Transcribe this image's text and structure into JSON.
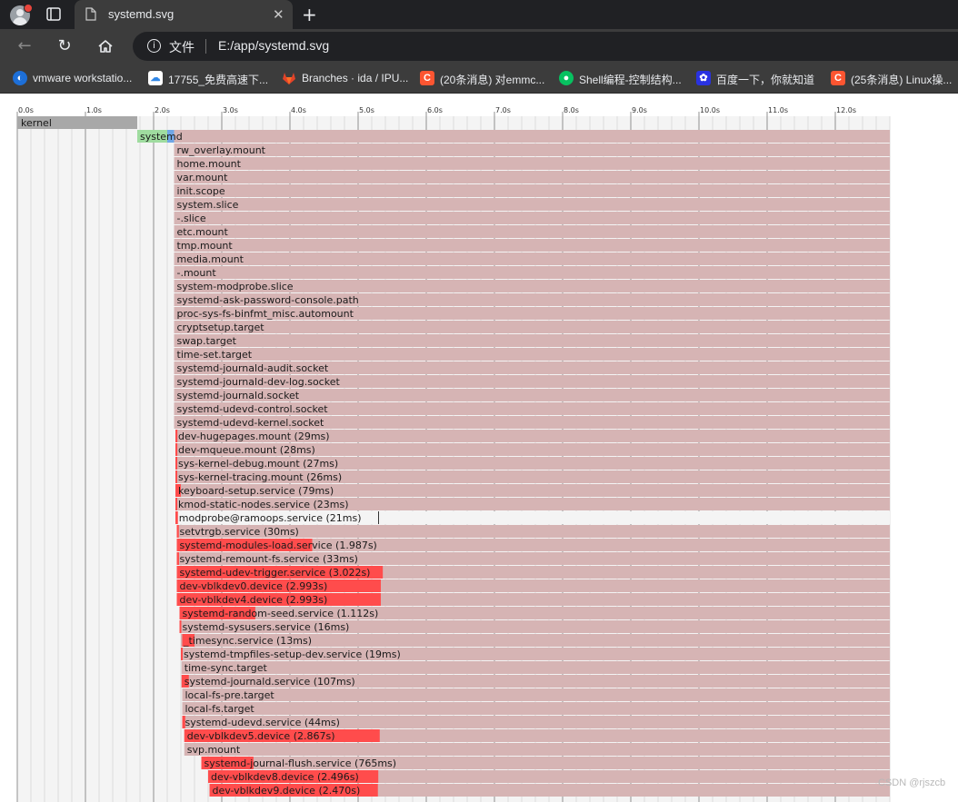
{
  "browser": {
    "tab_title": "systemd.svg",
    "address_chip": "文件",
    "url": "E:/app/systemd.svg",
    "colors": {
      "titlebar": "#202124",
      "toolbar": "#3c3c3c"
    }
  },
  "bookmarks": [
    {
      "label": "vmware workstatio...",
      "icon": "vmware-icon",
      "color": "#1d6fd8"
    },
    {
      "label": "17755_免费高速下...",
      "icon": "cloud-icon",
      "color": "#2f86e6"
    },
    {
      "label": "Branches · ida / IPU...",
      "icon": "gitlab-icon",
      "color": "#e24329"
    },
    {
      "label": "(20条消息) 对emmc...",
      "icon": "csdn-icon",
      "color": "#fc5531"
    },
    {
      "label": "Shell编程-控制结构...",
      "icon": "wechat-icon",
      "color": "#07c160"
    },
    {
      "label": "百度一下，你就知道",
      "icon": "baidu-icon",
      "color": "#2932e1"
    },
    {
      "label": "(25条消息) Linux操...",
      "icon": "csdn-icon",
      "color": "#fc5531"
    }
  ],
  "watermark": "CSDN @rjszcb",
  "chart_data": {
    "type": "bootchart-timeline",
    "x_unit": "s",
    "xlim": [
      0.0,
      12.8
    ],
    "ticks": [
      "0.0s",
      "1.0s",
      "2.0s",
      "3.0s",
      "4.0s",
      "5.0s",
      "6.0s",
      "7.0s",
      "8.0s",
      "9.0s",
      "10.0s",
      "11.0s",
      "12.0s"
    ],
    "colors": {
      "kernel": "#a8a8a8",
      "systemd_init": "#9fdc9f",
      "systemd_blue": "#6fa6e6",
      "bg": "#d6b4b4",
      "active": "#ff4c4c",
      "grid_major": "#909090",
      "grid_minor": "#dcdcdc"
    },
    "rows": [
      {
        "label": "kernel",
        "start": 0.0,
        "end": 1.76,
        "kind": "kernel"
      },
      {
        "label": "systemd",
        "start": 1.76,
        "end": 12.8,
        "kind": "systemd",
        "green_end": 2.2,
        "blue_end": 2.3
      },
      {
        "label": "rw_overlay.mount",
        "start": 2.3,
        "end": 12.8
      },
      {
        "label": "home.mount",
        "start": 2.3,
        "end": 12.8
      },
      {
        "label": "var.mount",
        "start": 2.3,
        "end": 12.8
      },
      {
        "label": "init.scope",
        "start": 2.3,
        "end": 12.8
      },
      {
        "label": "system.slice",
        "start": 2.3,
        "end": 12.8
      },
      {
        "label": "-.slice",
        "start": 2.3,
        "end": 12.8
      },
      {
        "label": "etc.mount",
        "start": 2.3,
        "end": 12.8
      },
      {
        "label": "tmp.mount",
        "start": 2.3,
        "end": 12.8
      },
      {
        "label": "media.mount",
        "start": 2.3,
        "end": 12.8
      },
      {
        "label": "-.mount",
        "start": 2.3,
        "end": 12.8
      },
      {
        "label": "system-modprobe.slice",
        "start": 2.3,
        "end": 12.8
      },
      {
        "label": "systemd-ask-password-console.path",
        "start": 2.3,
        "end": 12.8
      },
      {
        "label": "proc-sys-fs-binfmt_misc.automount",
        "start": 2.3,
        "end": 12.8
      },
      {
        "label": "cryptsetup.target",
        "start": 2.3,
        "end": 12.8
      },
      {
        "label": "swap.target",
        "start": 2.3,
        "end": 12.8
      },
      {
        "label": "time-set.target",
        "start": 2.3,
        "end": 12.8
      },
      {
        "label": "systemd-journald-audit.socket",
        "start": 2.3,
        "end": 12.8
      },
      {
        "label": "systemd-journald-dev-log.socket",
        "start": 2.3,
        "end": 12.8
      },
      {
        "label": "systemd-journald.socket",
        "start": 2.3,
        "end": 12.8
      },
      {
        "label": "systemd-udevd-control.socket",
        "start": 2.3,
        "end": 12.8
      },
      {
        "label": "systemd-udevd-kernel.socket",
        "start": 2.3,
        "end": 12.8
      },
      {
        "label": "dev-hugepages.mount (29ms)",
        "start": 2.32,
        "end": 12.8,
        "active_start": 2.32,
        "active_end": 2.349
      },
      {
        "label": "dev-mqueue.mount (28ms)",
        "start": 2.32,
        "end": 12.8,
        "active_start": 2.32,
        "active_end": 2.348
      },
      {
        "label": "sys-kernel-debug.mount (27ms)",
        "start": 2.32,
        "end": 12.8,
        "active_start": 2.32,
        "active_end": 2.347
      },
      {
        "label": "sys-kernel-tracing.mount (26ms)",
        "start": 2.32,
        "end": 12.8,
        "active_start": 2.32,
        "active_end": 2.346
      },
      {
        "label": "keyboard-setup.service (79ms)",
        "start": 2.32,
        "end": 12.8,
        "active_start": 2.32,
        "active_end": 2.399
      },
      {
        "label": "kmod-static-nodes.service (23ms)",
        "start": 2.32,
        "end": 12.8,
        "active_start": 2.32,
        "active_end": 2.343
      },
      {
        "label": "modprobe@ramoops.service (21ms)",
        "start": 2.33,
        "end": 12.8,
        "active_start": 2.33,
        "active_end": 2.351,
        "style": "inactive"
      },
      {
        "label": "setvtrgb.service (30ms)",
        "start": 2.34,
        "end": 12.8,
        "active_start": 2.34,
        "active_end": 2.37
      },
      {
        "label": "systemd-modules-load.service (1.987s)",
        "start": 2.34,
        "end": 12.8,
        "active_start": 2.34,
        "active_end": 4.327
      },
      {
        "label": "systemd-remount-fs.service (33ms)",
        "start": 2.34,
        "end": 12.8,
        "active_start": 2.34,
        "active_end": 2.373
      },
      {
        "label": "systemd-udev-trigger.service (3.022s)",
        "start": 2.34,
        "end": 12.8,
        "active_start": 2.34,
        "active_end": 5.362
      },
      {
        "label": "dev-vblkdev0.device (2.993s)",
        "start": 2.34,
        "end": 12.8,
        "active_start": 2.34,
        "active_end": 5.333
      },
      {
        "label": "dev-vblkdev4.device (2.993s)",
        "start": 2.34,
        "end": 12.8,
        "active_start": 2.34,
        "active_end": 5.333
      },
      {
        "label": "systemd-random-seed.service (1.112s)",
        "start": 2.38,
        "end": 12.8,
        "active_start": 2.38,
        "active_end": 3.492
      },
      {
        "label": "systemd-sysusers.service (16ms)",
        "start": 2.38,
        "end": 12.8,
        "active_start": 2.38,
        "active_end": 2.396
      },
      {
        "label": "_timesync.service (13ms)",
        "start": 2.4,
        "end": 12.8,
        "active_start": 2.42,
        "active_end": 2.6
      },
      {
        "label": "systemd-tmpfiles-setup-dev.service (19ms)",
        "start": 2.4,
        "end": 12.8,
        "active_start": 2.4,
        "active_end": 2.419
      },
      {
        "label": "time-sync.target",
        "start": 2.41,
        "end": 12.8
      },
      {
        "label": "systemd-journald.service (107ms)",
        "start": 2.41,
        "end": 12.8,
        "active_start": 2.41,
        "active_end": 2.517
      },
      {
        "label": "local-fs-pre.target",
        "start": 2.42,
        "end": 12.8
      },
      {
        "label": "local-fs.target",
        "start": 2.42,
        "end": 12.8
      },
      {
        "label": "systemd-udevd.service (44ms)",
        "start": 2.42,
        "end": 12.8,
        "active_start": 2.42,
        "active_end": 2.464
      },
      {
        "label": "dev-vblkdev5.device (2.867s)",
        "start": 2.45,
        "end": 12.8,
        "active_start": 2.45,
        "active_end": 5.317
      },
      {
        "label": "svp.mount",
        "start": 2.45,
        "end": 12.8
      },
      {
        "label": "systemd-journal-flush.service (765ms)",
        "start": 2.7,
        "end": 12.8,
        "active_start": 2.7,
        "active_end": 3.465
      },
      {
        "label": "dev-vblkdev8.device (2.496s)",
        "start": 2.8,
        "end": 12.8,
        "active_start": 2.8,
        "active_end": 5.296
      },
      {
        "label": "dev-vblkdev9.device (2.470s)",
        "start": 2.82,
        "end": 12.8,
        "active_start": 2.82,
        "active_end": 5.29
      }
    ]
  }
}
